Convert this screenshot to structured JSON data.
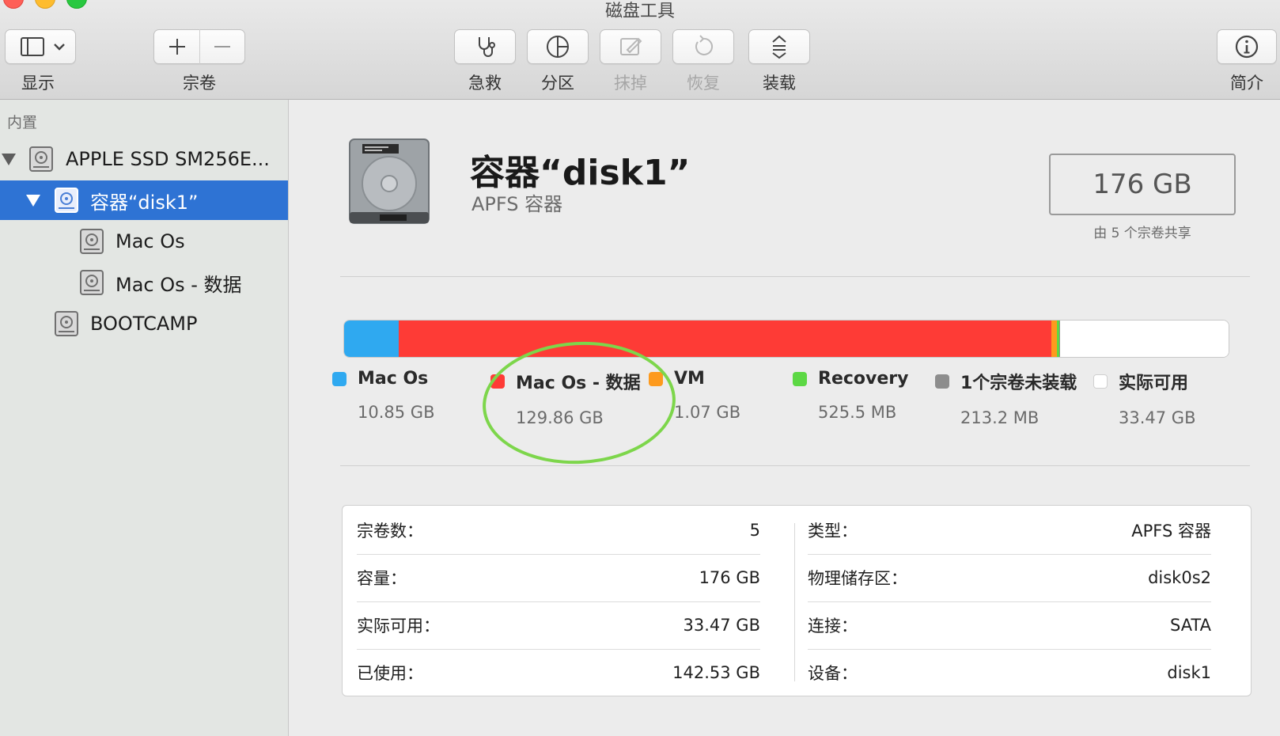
{
  "window": {
    "title": "磁盘工具"
  },
  "toolbar": {
    "view_label": "显示",
    "volume_label": "宗卷",
    "first_aid_label": "急救",
    "partition_label": "分区",
    "erase_label": "抹掉",
    "restore_label": "恢复",
    "mount_label": "装载",
    "info_label": "简介"
  },
  "sidebar": {
    "section": "内置",
    "items": [
      {
        "label": "APPLE SSD SM256E..."
      },
      {
        "label": "容器“disk1”"
      },
      {
        "label": "Mac Os"
      },
      {
        "label": "Mac Os - 数据"
      },
      {
        "label": "BOOTCAMP"
      }
    ]
  },
  "header": {
    "title": "容器“disk1”",
    "subtitle": "APFS 容器",
    "capacity": "176 GB",
    "capacity_note": "由 5 个宗卷共享"
  },
  "usage": {
    "total_gb": 176,
    "segments": [
      {
        "name": "Mac Os",
        "size": "10.85 GB",
        "gb": 10.85,
        "color": "#2fa9f0"
      },
      {
        "name": "Mac Os - 数据",
        "size": "129.86 GB",
        "gb": 129.86,
        "color": "#fe3b36"
      },
      {
        "name": "VM",
        "size": "1.07 GB",
        "gb": 1.07,
        "color": "#fd9a1e"
      },
      {
        "name": "Recovery",
        "size": "525.5 MB",
        "gb": 0.5255,
        "color": "#5cd844"
      },
      {
        "name": "1个宗卷未装载",
        "size": "213.2 MB",
        "gb": 0.2132,
        "color": "#8d8d8d"
      },
      {
        "name": "实际可用",
        "size": "33.47 GB",
        "gb": 33.47,
        "color": "#ffffff"
      }
    ]
  },
  "details": {
    "left": [
      {
        "label": "宗卷数：",
        "value": "5"
      },
      {
        "label": "容量：",
        "value": "176 GB"
      },
      {
        "label": "实际可用：",
        "value": "33.47 GB"
      },
      {
        "label": "已使用：",
        "value": "142.53 GB"
      }
    ],
    "right": [
      {
        "label": "类型：",
        "value": "APFS 容器"
      },
      {
        "label": "物理储存区：",
        "value": "disk0s2"
      },
      {
        "label": "连接：",
        "value": "SATA"
      },
      {
        "label": "设备：",
        "value": "disk1"
      }
    ]
  },
  "colors": {
    "selection": "#2e73d4",
    "annotation": "#7dd64b"
  }
}
